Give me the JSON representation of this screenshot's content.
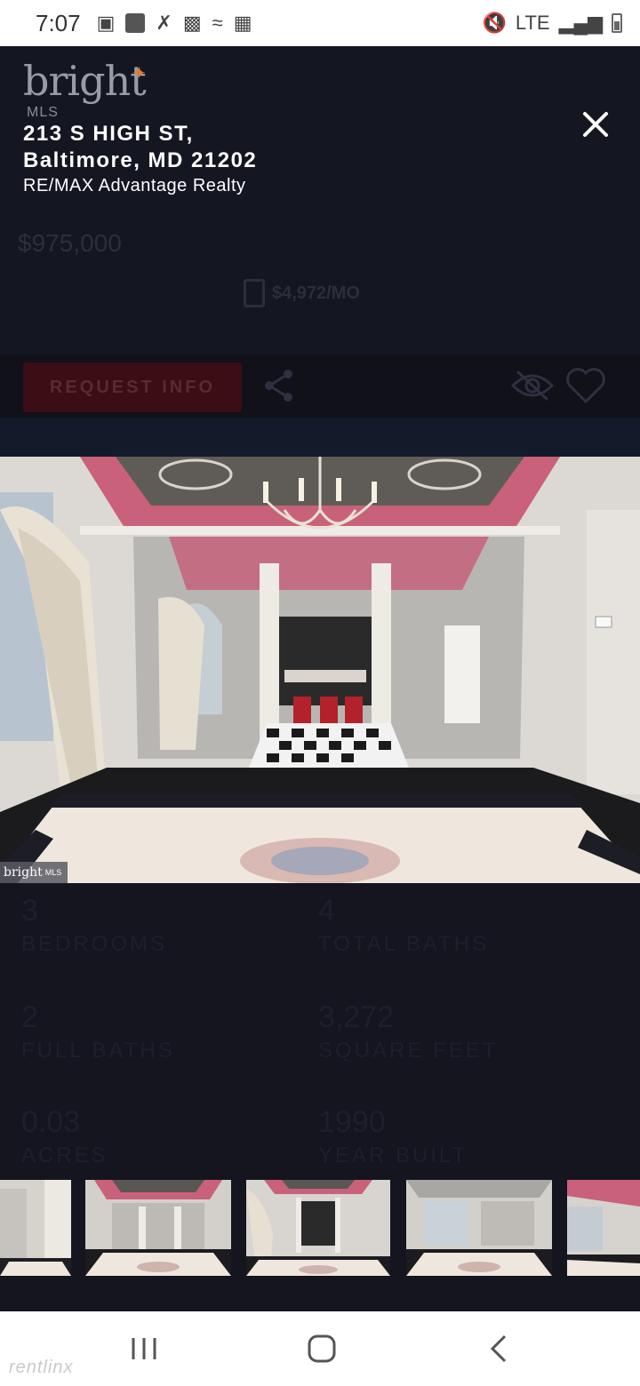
{
  "status_bar": {
    "time": "7:07",
    "network": "LTE"
  },
  "background_listing": {
    "logo": {
      "word": "bright",
      "sub": "MLS"
    },
    "price": "$975,000",
    "monthly_payment": "$4,972/MO",
    "request_button_label": "REQUEST INFO",
    "stats": [
      {
        "value": "3",
        "label": "BEDROOMS"
      },
      {
        "value": "4",
        "label": "TOTAL BATHS"
      },
      {
        "value": "2",
        "label": "FULL BATHS"
      },
      {
        "value": "3,272",
        "label": "SQUARE FEET"
      },
      {
        "value": "0.03",
        "label": "ACRES"
      },
      {
        "value": "1990",
        "label": "YEAR BUILT"
      }
    ]
  },
  "gallery": {
    "address_line1": "213 S HIGH ST,",
    "address_line2": "Baltimore, MD 21202",
    "brokerage": "RE/MAX Advantage Realty",
    "photo_watermark": {
      "word": "bright",
      "sub": "MLS"
    },
    "thumbnail_count": 5
  },
  "app_watermark": "rentlinx",
  "colors": {
    "accent_request": "#3b0d14",
    "overlay_bg": "#0a0b12",
    "ceiling_pink": "#c9617a"
  }
}
